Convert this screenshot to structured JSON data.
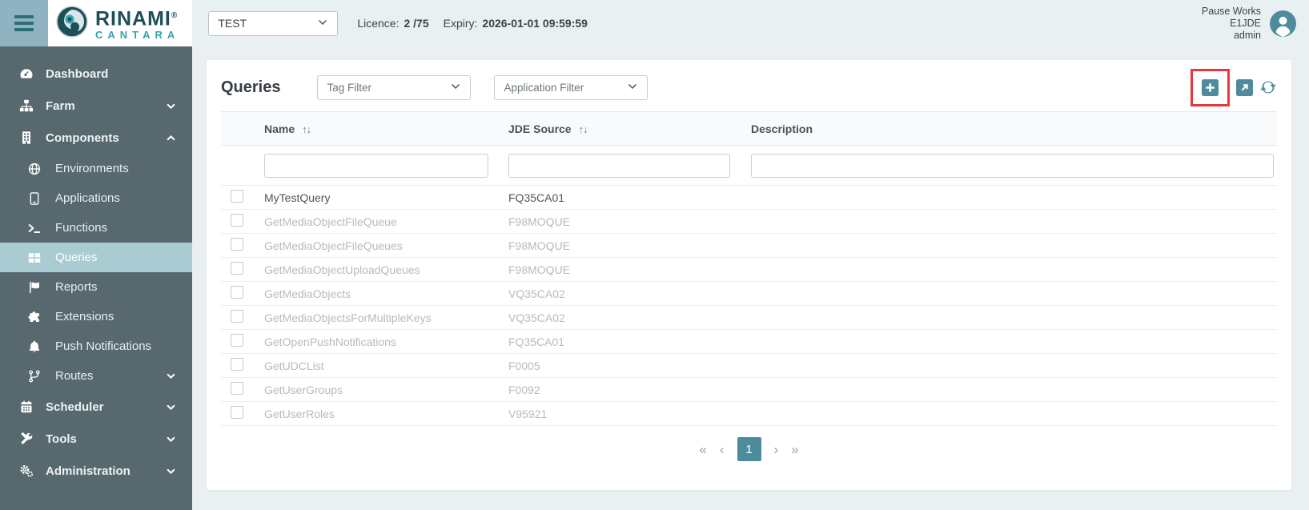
{
  "header": {
    "brand": {
      "name_top": "RINAMI",
      "registered_mark": "®",
      "name_bottom": "CANTARA"
    },
    "environment_select": {
      "value": "TEST"
    },
    "licence": {
      "label": "Licence:",
      "value": "2 /75"
    },
    "expiry": {
      "label": "Expiry:",
      "value": "2026-01-01 09:59:59"
    },
    "user": {
      "name": "Pause Works",
      "environment": "E1JDE",
      "role": "admin"
    }
  },
  "sidebar": {
    "items": [
      {
        "label": "Dashboard",
        "icon": "gauge",
        "level": 0,
        "chevron": ""
      },
      {
        "label": "Farm",
        "icon": "sitemap",
        "level": 0,
        "chevron": "down"
      },
      {
        "label": "Components",
        "icon": "building",
        "level": 0,
        "chevron": "up"
      },
      {
        "label": "Environments",
        "icon": "globe",
        "level": 1,
        "chevron": ""
      },
      {
        "label": "Applications",
        "icon": "tablet",
        "level": 1,
        "chevron": ""
      },
      {
        "label": "Functions",
        "icon": "terminal",
        "level": 1,
        "chevron": ""
      },
      {
        "label": "Queries",
        "icon": "table",
        "level": 1,
        "chevron": "",
        "active": true
      },
      {
        "label": "Reports",
        "icon": "flag",
        "level": 1,
        "chevron": ""
      },
      {
        "label": "Extensions",
        "icon": "puzzle",
        "level": 1,
        "chevron": ""
      },
      {
        "label": "Push Notifications",
        "icon": "bell",
        "level": 1,
        "chevron": ""
      },
      {
        "label": "Routes",
        "icon": "code-branch",
        "level": 1,
        "chevron": "down"
      },
      {
        "label": "Scheduler",
        "icon": "calendar",
        "level": 0,
        "chevron": "down"
      },
      {
        "label": "Tools",
        "icon": "tools",
        "level": 0,
        "chevron": "down"
      },
      {
        "label": "Administration",
        "icon": "cogs",
        "level": 0,
        "chevron": "down"
      }
    ]
  },
  "main": {
    "title": "Queries",
    "tag_filter": {
      "placeholder": "Tag Filter"
    },
    "application_filter": {
      "placeholder": "Application Filter"
    },
    "toolbar": {
      "actions": [
        {
          "icon": "plus-square",
          "name": "add",
          "highlighted": true
        },
        {
          "icon": "external-link-square",
          "name": "open"
        },
        {
          "icon": "refresh",
          "name": "refresh"
        }
      ]
    },
    "table": {
      "columns": [
        {
          "label": "Name",
          "sort_icon": "↑↓"
        },
        {
          "label": "JDE Source",
          "sort_icon": "↑↓"
        },
        {
          "label": "Description",
          "sort_icon": ""
        }
      ],
      "filters": [
        {
          "value": ""
        },
        {
          "value": ""
        },
        {
          "value": ""
        }
      ],
      "rows": [
        {
          "name": "MyTestQuery",
          "jde_source": "FQ35CA01",
          "description": "",
          "muted": false
        },
        {
          "name": "GetMediaObjectFileQueue",
          "jde_source": "F98MOQUE",
          "description": "",
          "muted": true
        },
        {
          "name": "GetMediaObjectFileQueues",
          "jde_source": "F98MOQUE",
          "description": "",
          "muted": true
        },
        {
          "name": "GetMediaObjectUploadQueues",
          "jde_source": "F98MOQUE",
          "description": "",
          "muted": true
        },
        {
          "name": "GetMediaObjects",
          "jde_source": "VQ35CA02",
          "description": "",
          "muted": true
        },
        {
          "name": "GetMediaObjectsForMultipleKeys",
          "jde_source": "VQ35CA02",
          "description": "",
          "muted": true
        },
        {
          "name": "GetOpenPushNotifications",
          "jde_source": "FQ35CA01",
          "description": "",
          "muted": true
        },
        {
          "name": "GetUDCList",
          "jde_source": "F0005",
          "description": "",
          "muted": true
        },
        {
          "name": "GetUserGroups",
          "jde_source": "F0092",
          "description": "",
          "muted": true
        },
        {
          "name": "GetUserRoles",
          "jde_source": "V95921",
          "description": "",
          "muted": true
        }
      ]
    },
    "pagination": {
      "first": "«",
      "previous": "‹",
      "page": "1",
      "next": "›",
      "last": "»"
    }
  },
  "colors": {
    "accent_teal": "#4f8b9d",
    "sidebar_bg": "#57696f",
    "active_item_bg": "#a9cbd2",
    "hamburger_bg": "#8fb3c0",
    "highlight_red": "#e5383b",
    "header_bg": "#e9f0f2",
    "logo_dark": "#1c4f58",
    "logo_teal": "#36a3ad",
    "muted_text": "#b5bbc0"
  }
}
